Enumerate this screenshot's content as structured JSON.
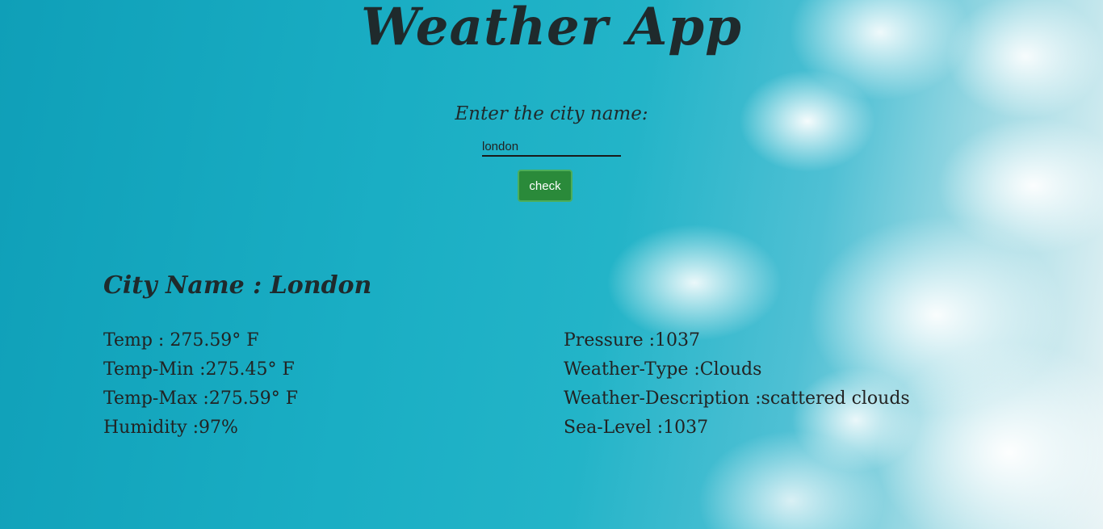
{
  "header": {
    "title": "Weather App"
  },
  "form": {
    "label": "Enter the city name:",
    "input_value": "london",
    "button_label": "check"
  },
  "result": {
    "city_line": "City Name : London",
    "left": [
      "Temp : 275.59° F",
      "Temp-Min :275.45° F",
      "Temp-Max :275.59° F",
      "Humidity :97%"
    ],
    "right": [
      "Pressure :1037",
      "Weather-Type :Clouds",
      "Weather-Description :scattered clouds",
      "Sea-Level :1037"
    ]
  },
  "colors": {
    "sky": "#1aaec4",
    "button": "#2a8a3a",
    "text": "#222222"
  }
}
